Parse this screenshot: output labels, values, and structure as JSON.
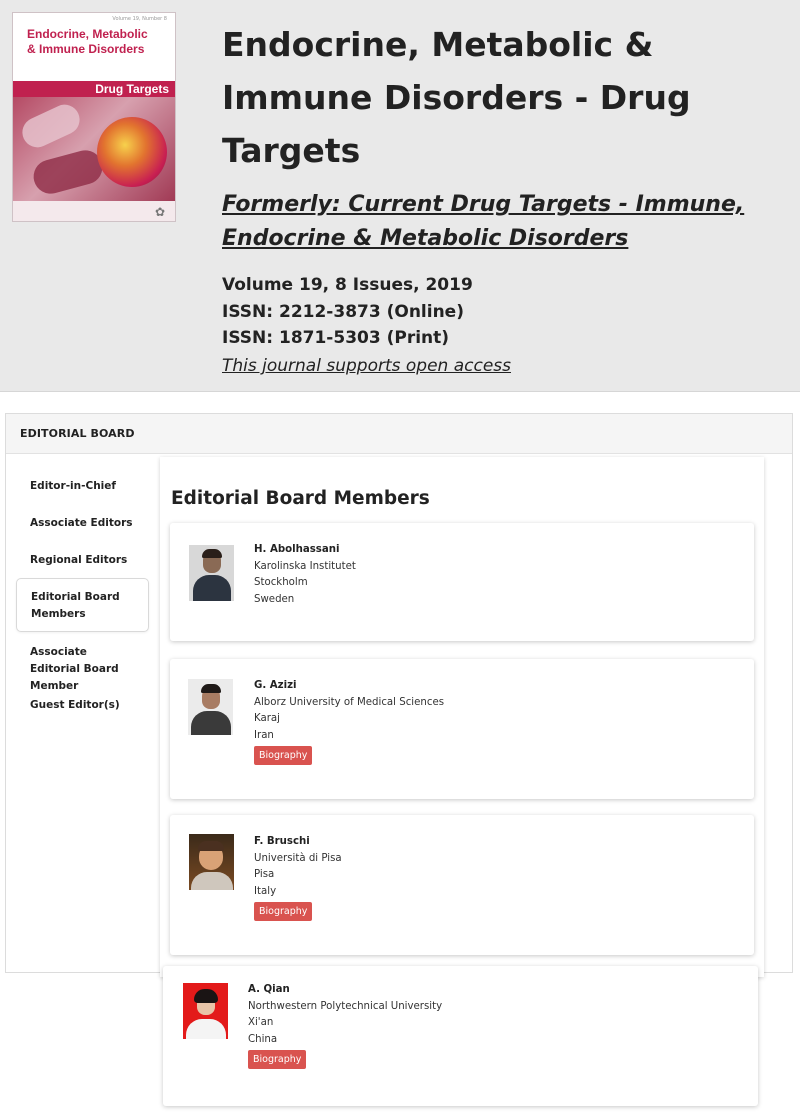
{
  "journal": {
    "cover": {
      "volume_tag": "Volume 19, Number 8",
      "title_line1": "Endocrine, Metabolic",
      "title_line2": "& Immune Disorders",
      "band": "Drug Targets"
    },
    "title": "Endocrine, Metabolic & Immune Disorders - Drug Targets",
    "formerly": "Formerly: Current Drug Targets - Immune, Endocrine & Metabolic Disorders",
    "volume": "Volume 19, 8 Issues, 2019",
    "issn_online": "ISSN: 2212-3873 (Online)",
    "issn_print": "ISSN: 1871-5303 (Print)",
    "open_access": "This journal supports open access"
  },
  "editorial_board": {
    "header": "EDITORIAL BOARD",
    "nav": [
      {
        "label": "Editor-in-Chief"
      },
      {
        "label": "Associate Editors"
      },
      {
        "label": "Regional Editors"
      },
      {
        "label": "Editorial Board Members"
      },
      {
        "label": "Associate Editorial Board Member"
      },
      {
        "label": "Guest Editor(s)"
      }
    ],
    "active_nav": "Editorial Board Members",
    "heading": "Editorial Board Members",
    "biography_label": "Biography",
    "members": [
      {
        "name": "H. Abolhassani",
        "institution": "Karolinska Institutet",
        "city": "Stockholm",
        "country": "Sweden"
      },
      {
        "name": "G. Azizi",
        "institution": "Alborz University of Medical Sciences",
        "city": "Karaj",
        "country": "Iran"
      },
      {
        "name": "F. Bruschi",
        "institution": "Università di Pisa",
        "city": "Pisa",
        "country": "Italy"
      },
      {
        "name": "A. Qian",
        "institution": "Northwestern Polytechnical University",
        "city": "Xi'an",
        "country": "China"
      }
    ]
  },
  "colors": {
    "header_bg": "#e9e9e9",
    "biography_button": "#d9534f",
    "cover_accent": "#c0214f"
  }
}
